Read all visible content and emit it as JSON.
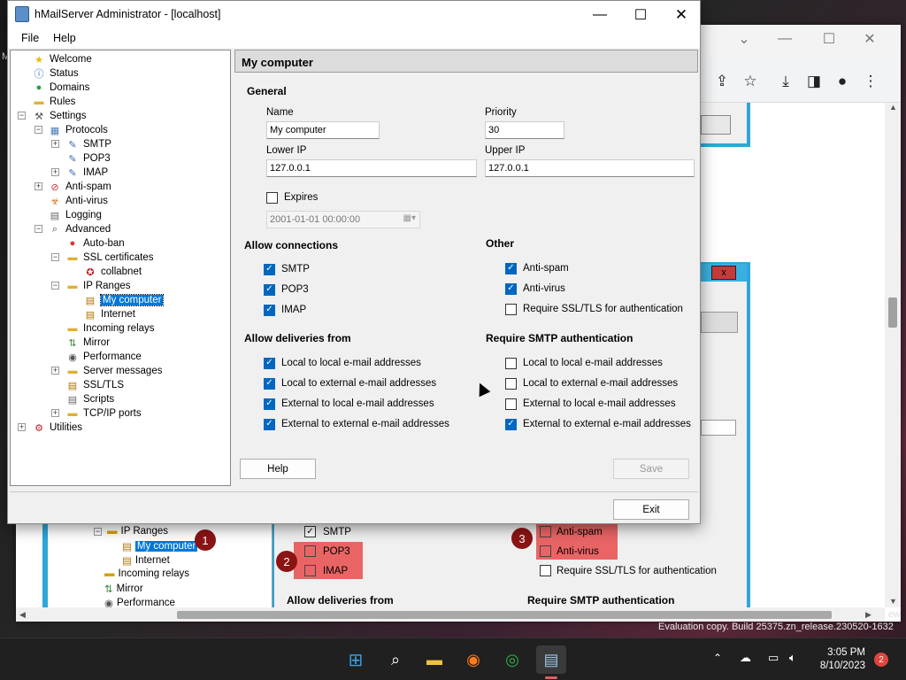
{
  "window": {
    "title": "hMailServer Administrator - [localhost]",
    "menu": [
      "File",
      "Help"
    ]
  },
  "tree": {
    "items": [
      {
        "label": "Welcome",
        "icon": "star-icon"
      },
      {
        "label": "Status",
        "icon": "info-icon"
      },
      {
        "label": "Domains",
        "icon": "globe-icon"
      },
      {
        "label": "Rules",
        "icon": "folder-icon"
      },
      {
        "label": "Settings",
        "icon": "tools-icon"
      },
      {
        "label": "Protocols",
        "icon": "protocol-icon"
      },
      {
        "label": "SMTP",
        "icon": "feather-icon"
      },
      {
        "label": "POP3",
        "icon": "feather-icon"
      },
      {
        "label": "IMAP",
        "icon": "feather-icon"
      },
      {
        "label": "Anti-spam",
        "icon": "antispam-icon"
      },
      {
        "label": "Anti-virus",
        "icon": "biohazard-icon"
      },
      {
        "label": "Logging",
        "icon": "document-icon"
      },
      {
        "label": "Advanced",
        "icon": "magnifier-icon"
      },
      {
        "label": "Auto-ban",
        "icon": "stop-icon"
      },
      {
        "label": "SSL certificates",
        "icon": "folder-icon"
      },
      {
        "label": "collabnet",
        "icon": "certificate-icon"
      },
      {
        "label": "IP Ranges",
        "icon": "folder-icon"
      },
      {
        "label": "My computer",
        "icon": "barrier-icon"
      },
      {
        "label": "Internet",
        "icon": "barrier-icon"
      },
      {
        "label": "Incoming relays",
        "icon": "folder-icon"
      },
      {
        "label": "Mirror",
        "icon": "mirror-icon"
      },
      {
        "label": "Performance",
        "icon": "gauge-icon"
      },
      {
        "label": "Server messages",
        "icon": "folder-icon"
      },
      {
        "label": "SSL/TLS",
        "icon": "barrier-icon"
      },
      {
        "label": "Scripts",
        "icon": "document-icon"
      },
      {
        "label": "TCP/IP ports",
        "icon": "folder-icon"
      },
      {
        "label": "Utilities",
        "icon": "utilities-icon"
      }
    ]
  },
  "form": {
    "header": "My computer",
    "general": "General",
    "name_label": "Name",
    "name_value": "My computer",
    "priority_label": "Priority",
    "priority_value": "30",
    "lower_ip_label": "Lower IP",
    "lower_ip_value": "127.0.0.1",
    "upper_ip_label": "Upper IP",
    "upper_ip_value": "127.0.0.1",
    "expires_label": "Expires",
    "expires_value": "2001-01-01 00:00:00",
    "allow_connections": "Allow connections",
    "conn": [
      {
        "label": "SMTP",
        "checked": true
      },
      {
        "label": "POP3",
        "checked": true
      },
      {
        "label": "IMAP",
        "checked": true
      }
    ],
    "other": "Other",
    "other_items": [
      {
        "label": "Anti-spam",
        "checked": true
      },
      {
        "label": "Anti-virus",
        "checked": true
      },
      {
        "label": "Require SSL/TLS for authentication",
        "checked": false
      }
    ],
    "allow_deliveries": "Allow deliveries from",
    "deliveries": [
      {
        "label": "Local to local e-mail addresses",
        "checked": true
      },
      {
        "label": "Local to external e-mail addresses",
        "checked": true
      },
      {
        "label": "External to local e-mail addresses",
        "checked": true
      },
      {
        "label": "External to external e-mail addresses",
        "checked": true
      }
    ],
    "require_smtp": "Require SMTP authentication",
    "smtp_auth": [
      {
        "label": "Local to local e-mail addresses",
        "checked": false
      },
      {
        "label": "Local to external e-mail addresses",
        "checked": false
      },
      {
        "label": "External to local e-mail addresses",
        "checked": false
      },
      {
        "label": "External to external e-mail addresses",
        "checked": true
      }
    ],
    "help_button": "Help",
    "save_button": "Save",
    "exit_button": "Exit"
  },
  "background": {
    "ip_ranges": "IP Ranges",
    "my_computer": "My computer",
    "internet": "Internet",
    "incoming_relays": "Incoming relays",
    "mirror": "Mirror",
    "performance": "Performance",
    "smtp": "SMTP",
    "pop3": "POP3",
    "imap": "IMAP",
    "anti_spam": "Anti-spam",
    "anti_virus": "Anti-virus",
    "require_ssl": "Require SSL/TLS for authentication",
    "allow_deliveries": "Allow deliveries from",
    "require_smtp": "Require SMTP authentication",
    "callouts": [
      "1",
      "2",
      "3"
    ],
    "eval_text": "Evaluation copy. Build 25375.zn_release.230520-1632",
    "edge_text": "ew",
    "left_edge": "M",
    "close_x": "x"
  },
  "taskbar": {
    "time": "3:05 PM",
    "date": "8/10/2023",
    "notification_count": "2"
  },
  "colors": {
    "accent": "#0067c0",
    "selection": "#0078d7",
    "callout": "#8b1414",
    "highlight": "#e74c4c",
    "frame": "#2ea7d8"
  }
}
